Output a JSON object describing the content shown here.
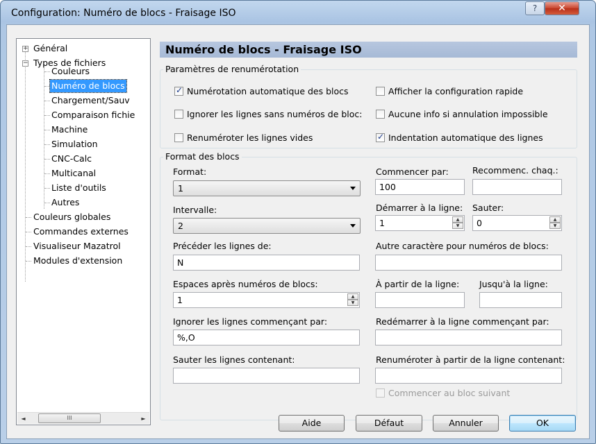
{
  "window": {
    "title": "Configuration: Numéro de blocs - Fraisage ISO",
    "help_label": "?",
    "close_label": "✕"
  },
  "tree": {
    "items": [
      {
        "label": "Général",
        "expander": "+"
      },
      {
        "label": "Types de fichiers",
        "expander": "−"
      },
      {
        "label": "Couleurs"
      },
      {
        "label": "Numéro de blocs",
        "selected": true
      },
      {
        "label": "Chargement/Sauv"
      },
      {
        "label": "Comparaison fichie"
      },
      {
        "label": "Machine"
      },
      {
        "label": "Simulation"
      },
      {
        "label": "CNC-Calc"
      },
      {
        "label": "Multicanal"
      },
      {
        "label": "Liste d'outils"
      },
      {
        "label": "Autres"
      },
      {
        "label": "Couleurs globales"
      },
      {
        "label": "Commandes externes"
      },
      {
        "label": "Visualiseur Mazatrol"
      },
      {
        "label": "Modules d'extension"
      }
    ],
    "scroll_left": "◄",
    "scroll_right": "►",
    "scroll_thumb": "III"
  },
  "panel": {
    "title": "Numéro de blocs - Fraisage ISO"
  },
  "renum_group": {
    "legend": "Paramètres de renumérotation",
    "options": {
      "auto_numbering": {
        "label": "Numérotation automatique des blocs",
        "checked": true
      },
      "quick_config": {
        "label": "Afficher la configuration rapide",
        "checked": false
      },
      "ignore_no_numbers": {
        "label": "Ignorer les lignes sans numéros de bloc:",
        "checked": false
      },
      "no_info_cancel": {
        "label": "Aucune info si annulation impossible",
        "checked": false
      },
      "renumber_empty": {
        "label": "Renuméroter les lignes vides",
        "checked": false
      },
      "auto_indent": {
        "label": "Indentation automatique des lignes",
        "checked": true
      }
    }
  },
  "format_group": {
    "legend": "Format des blocs",
    "format": {
      "label": "Format:",
      "value": "1"
    },
    "start_with": {
      "label": "Commencer par:",
      "value": "100"
    },
    "restart_each": {
      "label": "Recommenc. chaq.:",
      "value": ""
    },
    "interval": {
      "label": "Intervalle:",
      "value": "2"
    },
    "start_line": {
      "label": "Démarrer à la ligne:",
      "value": "1"
    },
    "skip": {
      "label": "Sauter:",
      "value": "0"
    },
    "prefix": {
      "label": "Précéder les lignes de:",
      "value": "N"
    },
    "other_char": {
      "label": "Autre caractère pour numéros de blocs:",
      "value": ""
    },
    "spaces_after": {
      "label": "Espaces après numéros de blocs:",
      "value": "1"
    },
    "from_line": {
      "label": "À partir de la ligne:",
      "value": ""
    },
    "to_line": {
      "label": "Jusqu'à la ligne:",
      "value": ""
    },
    "ignore_starting": {
      "label": "Ignorer les lignes commençant par:",
      "value": "%,O"
    },
    "restart_starting": {
      "label": "Redémarrer à la ligne commençant par:",
      "value": ""
    },
    "skip_containing": {
      "label": "Sauter les lignes contenant:",
      "value": ""
    },
    "renumber_from_containing": {
      "label": "Renuméroter à partir de la ligne contenant:",
      "value": ""
    },
    "start_next_block": {
      "label": "Commencer au bloc suivant",
      "checked": false
    }
  },
  "buttons": {
    "help": "Aide",
    "default": "Défaut",
    "cancel": "Annuler",
    "ok": "OK"
  }
}
